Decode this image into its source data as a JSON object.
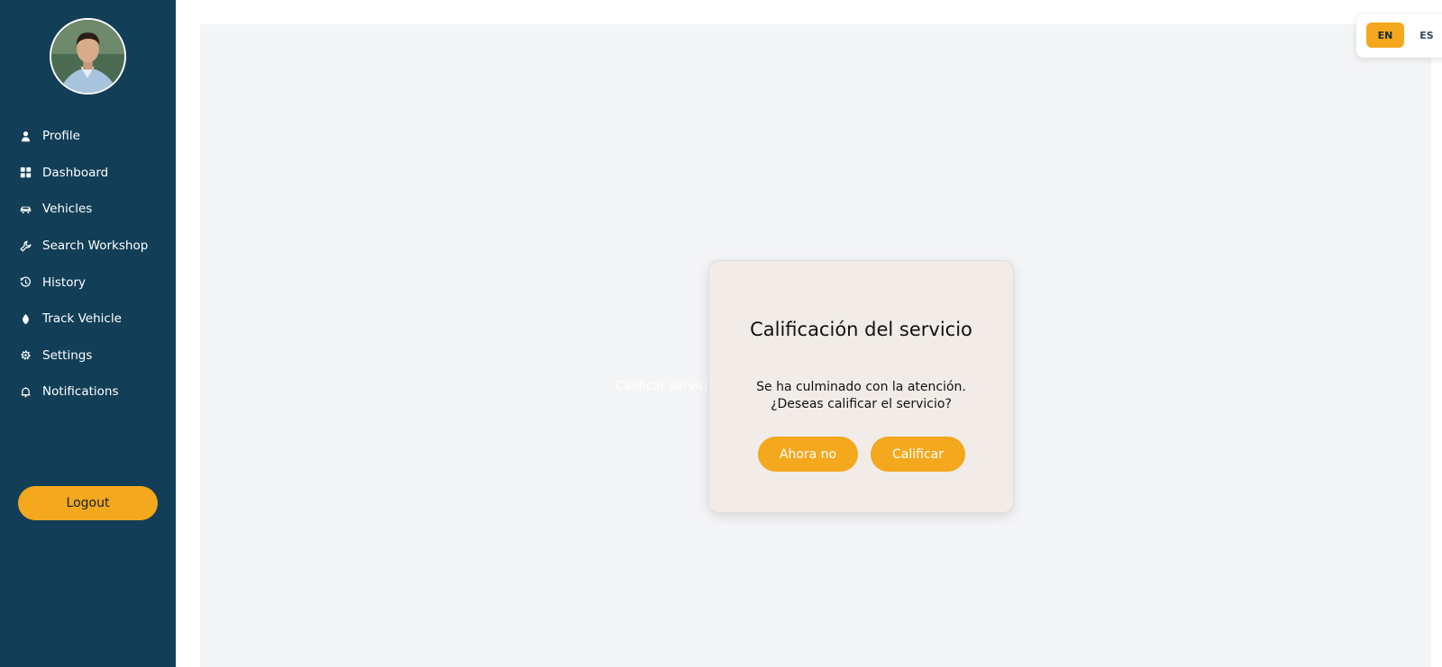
{
  "sidebar": {
    "items": [
      {
        "label": "Profile",
        "icon": "user-icon"
      },
      {
        "label": "Dashboard",
        "icon": "grid-icon"
      },
      {
        "label": "Vehicles",
        "icon": "car-icon"
      },
      {
        "label": "Search Workshop",
        "icon": "wrench-icon"
      },
      {
        "label": "History",
        "icon": "history-icon"
      },
      {
        "label": "Track Vehicle",
        "icon": "location-icon"
      },
      {
        "label": "Settings",
        "icon": "gear-icon"
      },
      {
        "label": "Notifications",
        "icon": "bell-icon"
      }
    ],
    "logout_label": "Logout"
  },
  "main": {
    "ghost_text": "Calificar servicio"
  },
  "modal": {
    "title": "Calificación del servicio",
    "message_line1": "Se ha culminado con la atención.",
    "message_line2": "¿Deseas calificar el servicio?",
    "later_label": "Ahora no",
    "rate_label": "Calificar"
  },
  "language": {
    "en_label": "EN",
    "es_label": "ES",
    "selected": "EN"
  },
  "colors": {
    "sidebar_bg": "#123f57",
    "accent": "#f3a81d",
    "main_bg": "#f4f5f7",
    "modal_bg": "#f1ece7"
  }
}
